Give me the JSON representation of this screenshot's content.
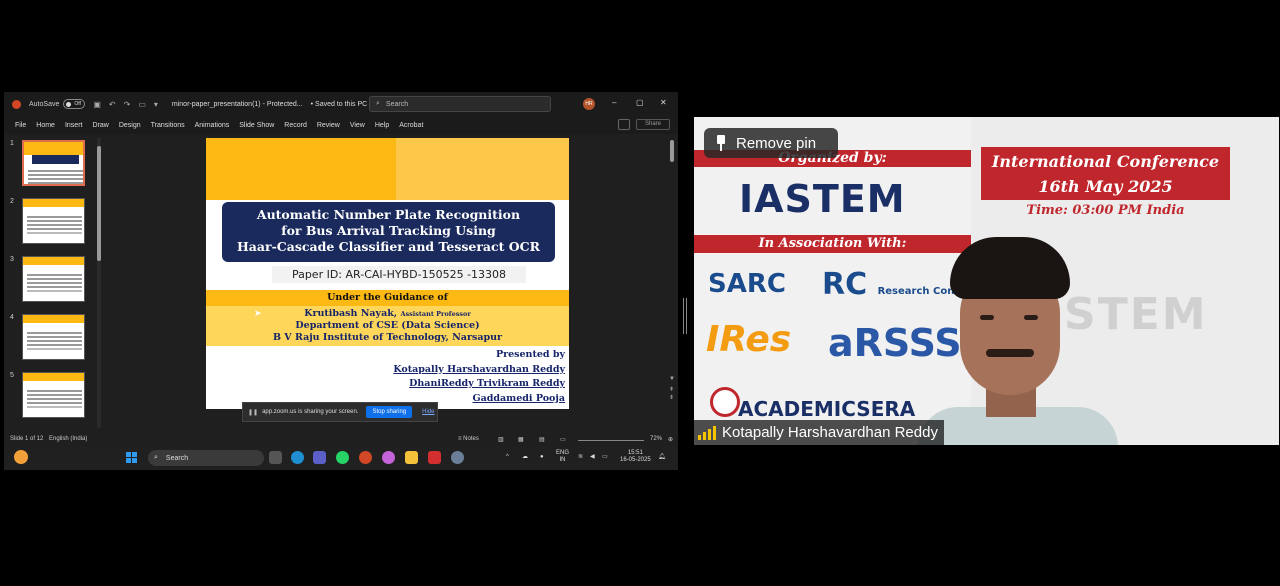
{
  "share": {
    "titlebar": {
      "autosave_label": "AutoSave",
      "autosave_state": "Off",
      "filename": "minor-paper_presentation(1) - Protected...",
      "saved_status": "• Saved to this PC",
      "search_placeholder": "Search",
      "avatar_initials": "HR"
    },
    "menu": [
      "File",
      "Home",
      "Insert",
      "Draw",
      "Design",
      "Transitions",
      "Animations",
      "Slide Show",
      "Record",
      "Review",
      "View",
      "Help",
      "Acrobat"
    ],
    "share_button": "Share",
    "thumbnails": [
      {
        "num": "1",
        "active": true
      },
      {
        "num": "2",
        "active": false
      },
      {
        "num": "3",
        "active": false
      },
      {
        "num": "4",
        "active": false
      },
      {
        "num": "5",
        "active": false
      }
    ],
    "slide": {
      "title_line1": "Automatic Number Plate Recognition",
      "title_line2": "for Bus Arrival Tracking Using",
      "title_line3": "Haar-Cascade Classifier and Tesseract OCR",
      "paper_id": "Paper ID: AR-CAI-HYBD-150525 -13308",
      "guidance_heading": "Under the Guidance of",
      "guide_name": "Krutibash Nayak,",
      "guide_title": "Assistant Professor",
      "guide_dept": "Department of CSE (Data Science)",
      "guide_inst": "B V Raju Institute of Technology, Narsapur",
      "presented_by": "Presented by",
      "presenters": [
        "Kotapally Harshavardhan Reddy",
        "DhaniReddy Trivikram Reddy",
        "Gaddamedi Pooja"
      ]
    },
    "zoom_banner": {
      "message": "app.zoom.us is sharing your screen.",
      "stop_label": "Stop sharing",
      "hide_label": "Hide"
    },
    "status": {
      "slide_count": "Slide 1 of 12",
      "language": "English (India)",
      "notes": "Notes",
      "zoom_level": "72%"
    },
    "taskbar": {
      "search_placeholder": "Search",
      "lang_top": "ENG",
      "lang_bottom": "IN",
      "time": "15:51",
      "date": "16-05-2025"
    }
  },
  "video": {
    "pin_button_label": "Remove pin",
    "participant_name": "Kotapally Harshavardhan Reddy",
    "backdrop": {
      "organized_by": "Organized by:",
      "org_logo": "IASTEM",
      "association": "In Association With:",
      "conference_line1": "International Conference",
      "conference_line2": "16th May 2025",
      "time_line": "Time: 03:00 PM India",
      "logo_sarc": "SARC",
      "logo_rc": "RC",
      "logo_rc_text": "Research Conference",
      "logo_ires": "IRes",
      "logo_arsss": "aRSSS",
      "logo_academics": "ACADEMICSERA",
      "watermark": "STEM"
    }
  },
  "colors": {
    "slide_yellow": "#fcb913",
    "slide_navy": "#1a2a5c",
    "backdrop_red": "#c0272d",
    "zoom_blue": "#0e71eb"
  }
}
